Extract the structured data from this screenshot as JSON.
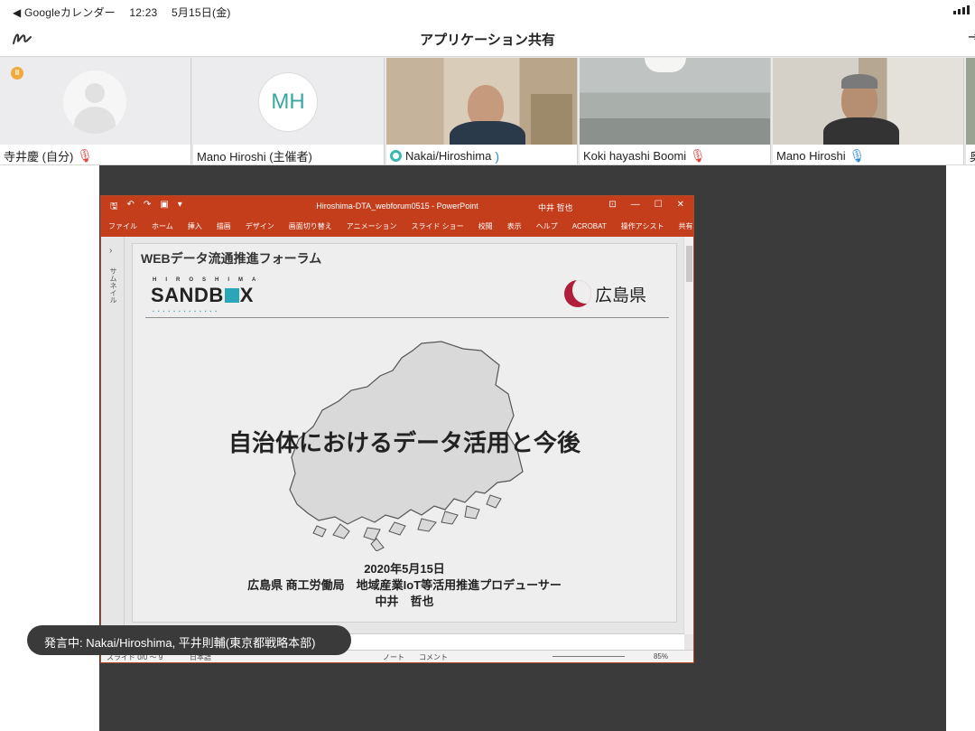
{
  "status_bar": {
    "back_app": "◀ Googleカレンダー",
    "time": "12:23",
    "date": "5月15日(金)"
  },
  "app_bar": {
    "title": "アプリケーション共有"
  },
  "participants": [
    {
      "name": "寺井慶 (自分)",
      "mic": "muted"
    },
    {
      "name": "Mano Hiroshi (主催者)",
      "initials": "MH"
    },
    {
      "name": "Nakai/Hiroshima",
      "mic": "speaking"
    },
    {
      "name": "Koki hayashi Boomi",
      "mic": "muted"
    },
    {
      "name": "Mano Hiroshi",
      "mic": "on"
    },
    {
      "name": "奥"
    }
  ],
  "powerpoint": {
    "doc_title": "Hiroshima-DTA_webforum0515  -  PowerPoint",
    "user": "中井 哲也",
    "ribbon_tabs": [
      "ファイル",
      "ホーム",
      "挿入",
      "描画",
      "デザイン",
      "画面切り替え",
      "アニメーション",
      "スライド ショー",
      "校閲",
      "表示",
      "ヘルプ",
      "ACROBAT",
      "操作アシスト",
      "共有"
    ],
    "rail_label": "サムネイル",
    "status_slide": "スライド 0/0 ～ 9",
    "status_lang": "日本語",
    "status_notes": "ノート",
    "status_comments": "コメント",
    "zoom": "85%"
  },
  "slide": {
    "forum": "WEBデータ流通推進フォーラム",
    "logo_sub": "HIROSHIMA",
    "logo_main_a": "SANDB",
    "logo_main_b": "X",
    "prefecture": "広島県",
    "title": "自治体におけるデータ活用と今後",
    "date": "2020年5月15日",
    "organization": "広島県 商工労働局　地域産業IoT等活用推進プロデューサー",
    "presenter": "中井　哲也"
  },
  "toast": {
    "text": "発言中: Nakai/Hiroshima, 平井則輔(東京都戦略本部)"
  },
  "colors": {
    "ppt_red": "#c43e1c",
    "mic_muted": "#e0433d",
    "mic_on": "#2a8ad8",
    "accent_teal": "#3aa6a4"
  }
}
